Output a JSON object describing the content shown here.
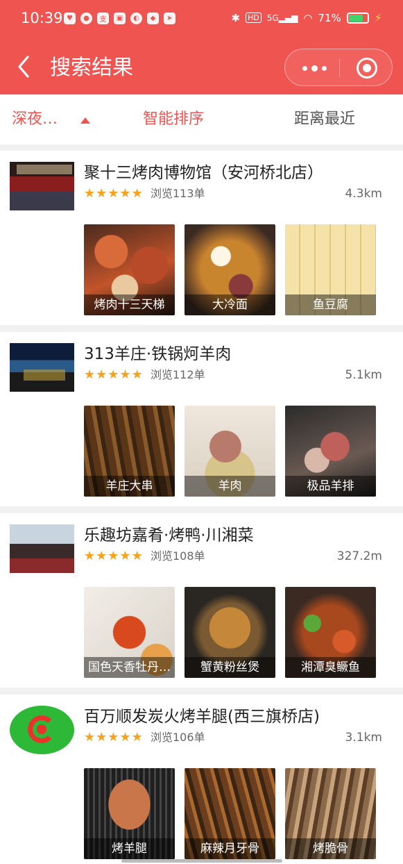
{
  "status_bar": {
    "time": "10:39",
    "network": "5G",
    "battery_percent": "71%",
    "battery_level": 0.71
  },
  "nav": {
    "title": "搜索结果"
  },
  "filters": {
    "category": "深夜…",
    "sort": "智能排序",
    "distance": "距离最近"
  },
  "results": [
    {
      "name": "聚十三烤肉博物馆（安河桥北店）",
      "rating_stars": 5,
      "views": "浏览113单",
      "distance": "4.3km",
      "dishes": [
        "烤肉十三天梯",
        "大冷面",
        "鱼豆腐"
      ]
    },
    {
      "name": "313羊庄·铁锅炣羊肉",
      "rating_stars": 5,
      "views": "浏览112单",
      "distance": "5.1km",
      "dishes": [
        "羊庄大串",
        "羊肉",
        "极品羊排"
      ]
    },
    {
      "name": "乐趣坊嘉肴·烤鸭·川湘菜",
      "rating_stars": 5,
      "views": "浏览108单",
      "distance": "327.2m",
      "dishes": [
        "国色天香牡丹…",
        "蟹黄粉丝煲",
        "湘潭臭鳜鱼"
      ]
    },
    {
      "name": "百万顺发炭火烤羊腿(西三旗桥店)",
      "rating_stars": 5,
      "views": "浏览106单",
      "distance": "3.1km",
      "dishes": [
        "烤羊腿",
        "麻辣月牙骨",
        "烤脆骨"
      ]
    }
  ],
  "colors": {
    "brand_red": "#f05451",
    "star": "#f7a21b",
    "separator": "#f1f1f1"
  }
}
